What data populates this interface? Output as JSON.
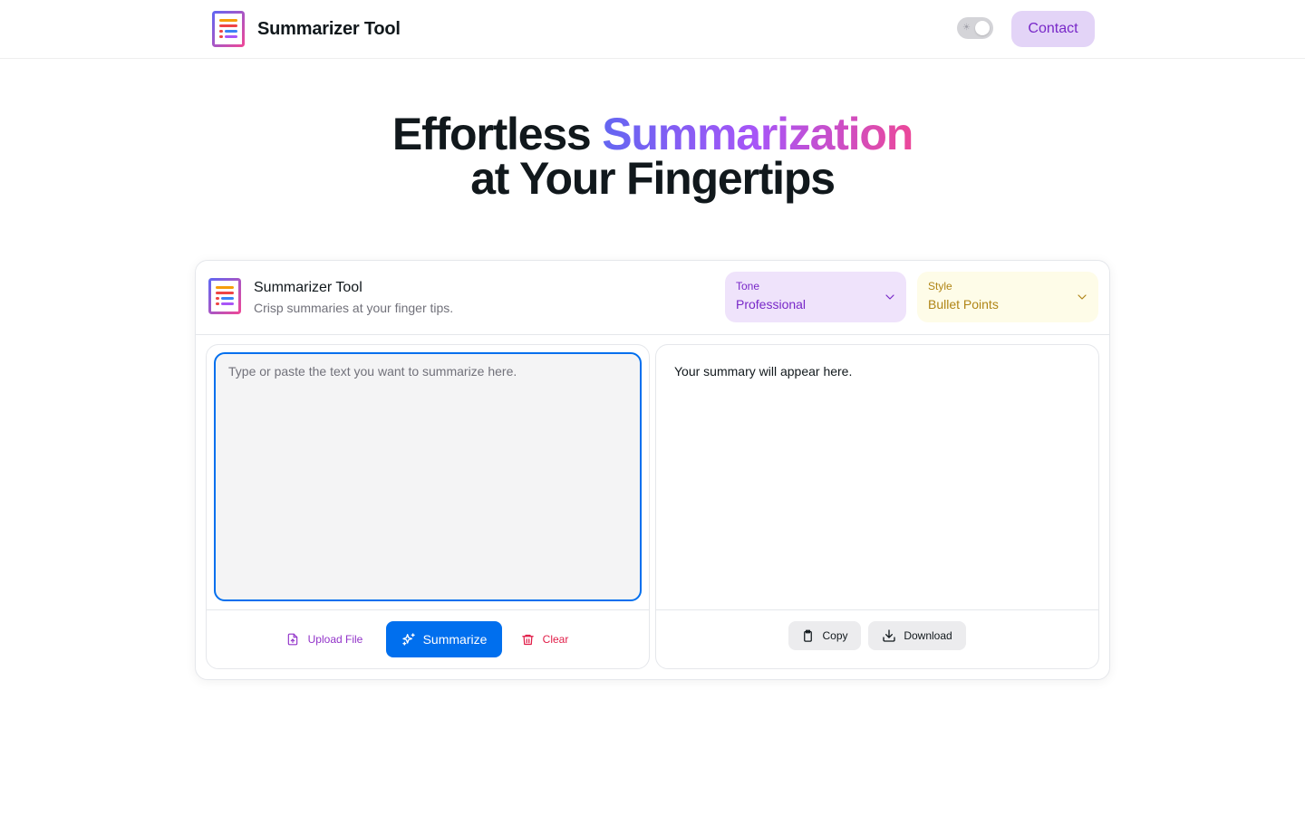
{
  "navbar": {
    "brand": "Summarizer Tool",
    "theme_toggle_icon": "sun-icon",
    "contact_label": "Contact"
  },
  "hero": {
    "line1_plain": "Effortless",
    "line1_highlight": "Summarization",
    "line2": "at Your Fingertips",
    "gradient_colors": [
      "#6366f1",
      "#a855f7",
      "#ec4899"
    ]
  },
  "card": {
    "title": "Summarizer Tool",
    "subtitle": "Crisp summaries at your finger tips.",
    "tone": {
      "label": "Tone",
      "value": "Professional"
    },
    "style": {
      "label": "Style",
      "value": "Bullet Points"
    }
  },
  "input": {
    "placeholder": "Type or paste the text you want to summarize here.",
    "value": ""
  },
  "input_actions": {
    "upload_label": "Upload File",
    "summarize_label": "Summarize",
    "clear_label": "Clear"
  },
  "output": {
    "placeholder_text": "Your summary will appear here."
  },
  "output_actions": {
    "copy_label": "Copy",
    "download_label": "Download"
  },
  "colors": {
    "primary": "#006fee",
    "secondary": "#7828c8",
    "danger": "#e11d48",
    "warning_text": "#b08516"
  }
}
